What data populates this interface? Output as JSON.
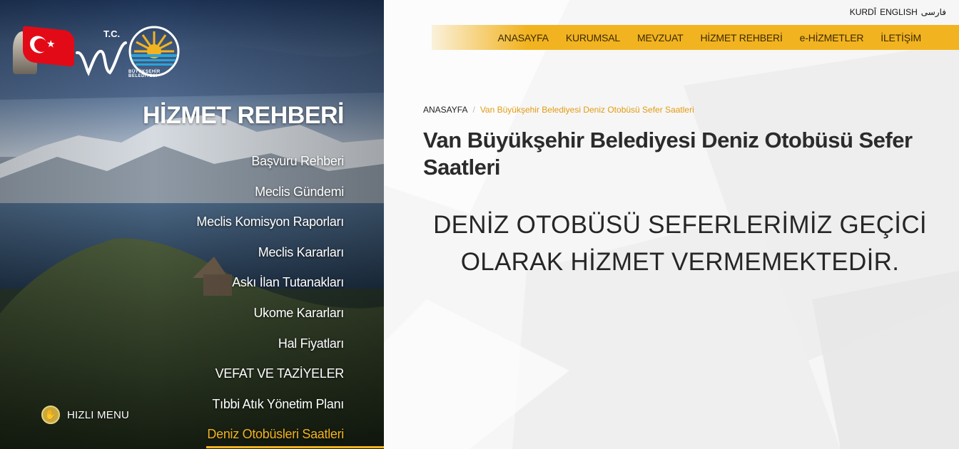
{
  "sidebar": {
    "logo": {
      "tc": "T.C.",
      "org": "BÜYÜKŞEHİR BELEDİYESİ"
    },
    "title": "HİZMET REHBERİ",
    "items": [
      {
        "label": "Başvuru Rehberi"
      },
      {
        "label": "Meclis Gündemi"
      },
      {
        "label": "Meclis Komisyon Raporları"
      },
      {
        "label": "Meclis Kararları"
      },
      {
        "label": "Askı İlan Tutanakları"
      },
      {
        "label": "Ukome Kararları"
      },
      {
        "label": "Hal Fiyatları"
      },
      {
        "label": "VEFAT VE TAZİYELER"
      },
      {
        "label": "Tıbbi Atık Yönetim Planı"
      },
      {
        "label": "Deniz Otobüsleri Saatleri"
      }
    ],
    "quick_menu": {
      "label": "HIZLI MENU",
      "icon": "hand-icon"
    }
  },
  "languages": [
    "KURDÎ",
    "ENGLISH",
    "فارسی"
  ],
  "nav": [
    "ANASAYFA",
    "KURUMSAL",
    "MEVZUAT",
    "HİZMET REHBERİ",
    "e-HİZMETLER",
    "İLETİŞİM"
  ],
  "breadcrumb": {
    "home": "ANASAYFA",
    "separator": "/",
    "current": "Van Büyükşehir Belediyesi Deniz Otobüsü Sefer Saatleri"
  },
  "page": {
    "title": "Van Büyükşehir Belediyesi Deniz Otobüsü Sefer Saatleri",
    "notice_line1": "DENİZ OTOBÜSÜ SEFERLERİMİZ GEÇİCİ",
    "notice_line2": "OLARAK HİZMET VERMEMEKTEDİR."
  },
  "colors": {
    "accent": "#f2b320",
    "text": "#2b2b2b",
    "active": "#e29b12"
  }
}
